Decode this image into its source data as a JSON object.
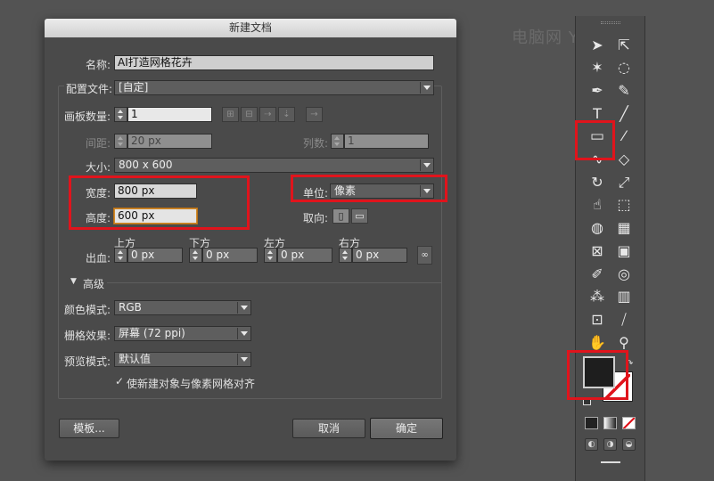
{
  "dialog": {
    "title": "新建文档",
    "name_label": "名称:",
    "name_value": "AI打造网格花卉",
    "profile_label": "配置文件:",
    "profile_value": "[自定]",
    "artboards_label": "画板数量:",
    "artboards_value": "1",
    "spacing_label": "间距:",
    "spacing_value": "20 px",
    "columns_label": "列数:",
    "columns_value": "1",
    "size_label": "大小:",
    "size_value": "800 x 600",
    "width_label": "宽度:",
    "width_value": "800 px",
    "height_label": "高度:",
    "height_value": "600 px",
    "units_label": "单位:",
    "units_value": "像素",
    "orientation_label": "取向:",
    "bleed_label": "出血:",
    "bleed": {
      "top_label": "上方",
      "top_value": "0 px",
      "bottom_label": "下方",
      "bottom_value": "0 px",
      "left_label": "左方",
      "left_value": "0 px",
      "right_label": "右方",
      "right_value": "0 px"
    },
    "advanced_label": "高级",
    "color_mode_label": "颜色模式:",
    "color_mode_value": "RGB",
    "raster_label": "栅格效果:",
    "raster_value": "屏幕 (72 ppi)",
    "preview_label": "预览模式:",
    "preview_value": "默认值",
    "align_checkbox_label": "使新建对象与像素网格对齐",
    "templates_button": "模板...",
    "cancel_button": "取消",
    "ok_button": "确定"
  },
  "watermark": "电脑网 Y    tom",
  "colors": {
    "highlight_box": "#e0141c",
    "canvas_bg": "#535353",
    "dialog_bg": "#4a4a4a"
  },
  "toolbar": {
    "tools": [
      "selection-icon",
      "direct-selection-icon",
      "magic-wand-icon",
      "lasso-icon",
      "pen-icon",
      "curvature-icon",
      "type-icon",
      "line-icon",
      "rectangle-icon",
      "paintbrush-icon",
      "shaper-icon",
      "eraser-icon",
      "rotate-icon",
      "scale-icon",
      "warp-icon",
      "free-transform-icon",
      "shape-builder-icon",
      "perspective-icon",
      "mesh-icon",
      "gradient-icon",
      "eyedropper-icon",
      "blend-icon",
      "symbol-sprayer-icon",
      "column-graph-icon",
      "artboard-icon",
      "slice-icon",
      "hand-icon",
      "zoom-icon"
    ]
  }
}
